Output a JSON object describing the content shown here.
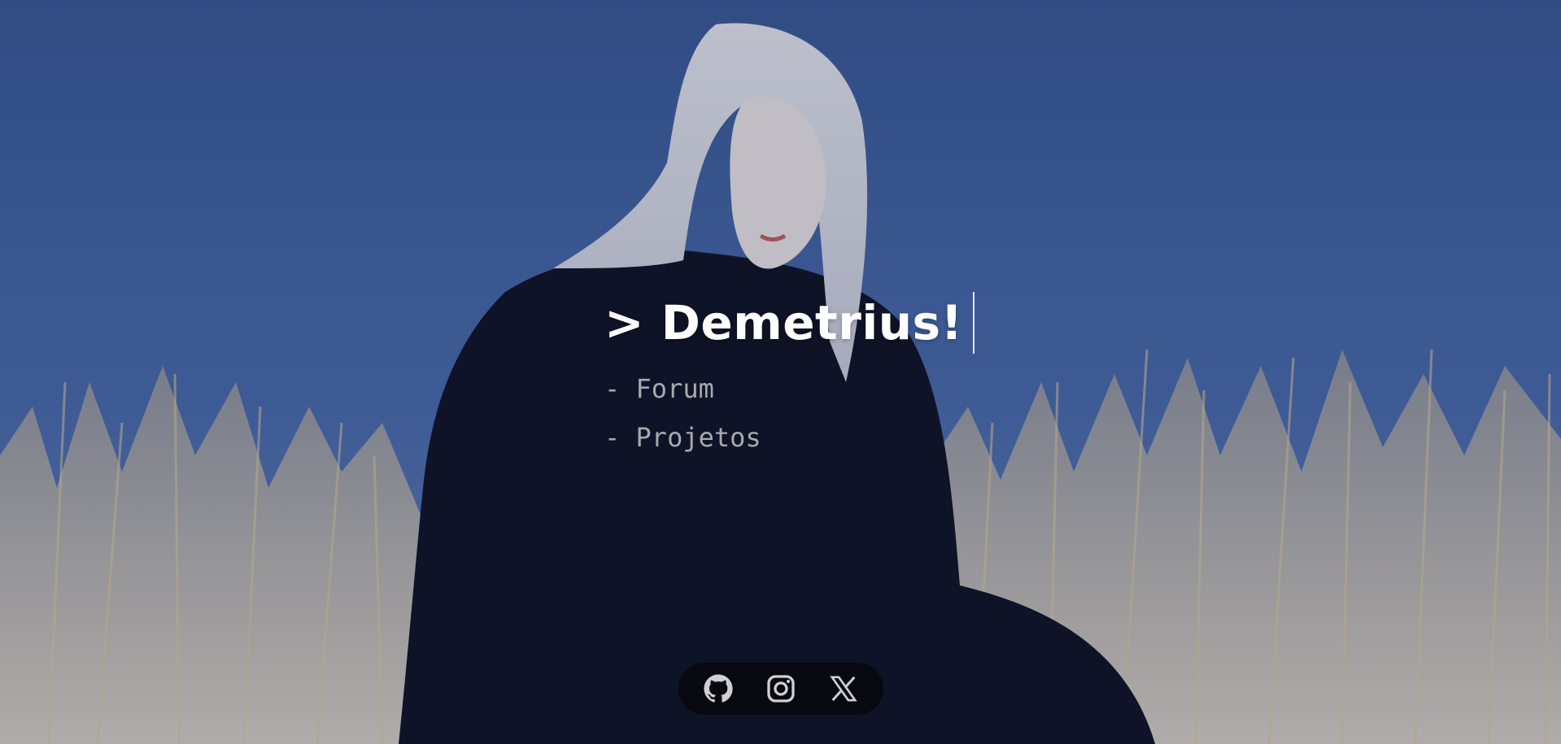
{
  "header": {
    "title": "> Demetrius!"
  },
  "nav": {
    "items": [
      {
        "label": "- Forum"
      },
      {
        "label": "- Projetos"
      }
    ]
  },
  "social": {
    "icons": [
      "github-icon",
      "instagram-icon",
      "x-icon"
    ]
  },
  "colors": {
    "title": "#ffffff",
    "links": "#a8a8ae",
    "sky": "#4466aa",
    "social_bar": "#08080e"
  }
}
